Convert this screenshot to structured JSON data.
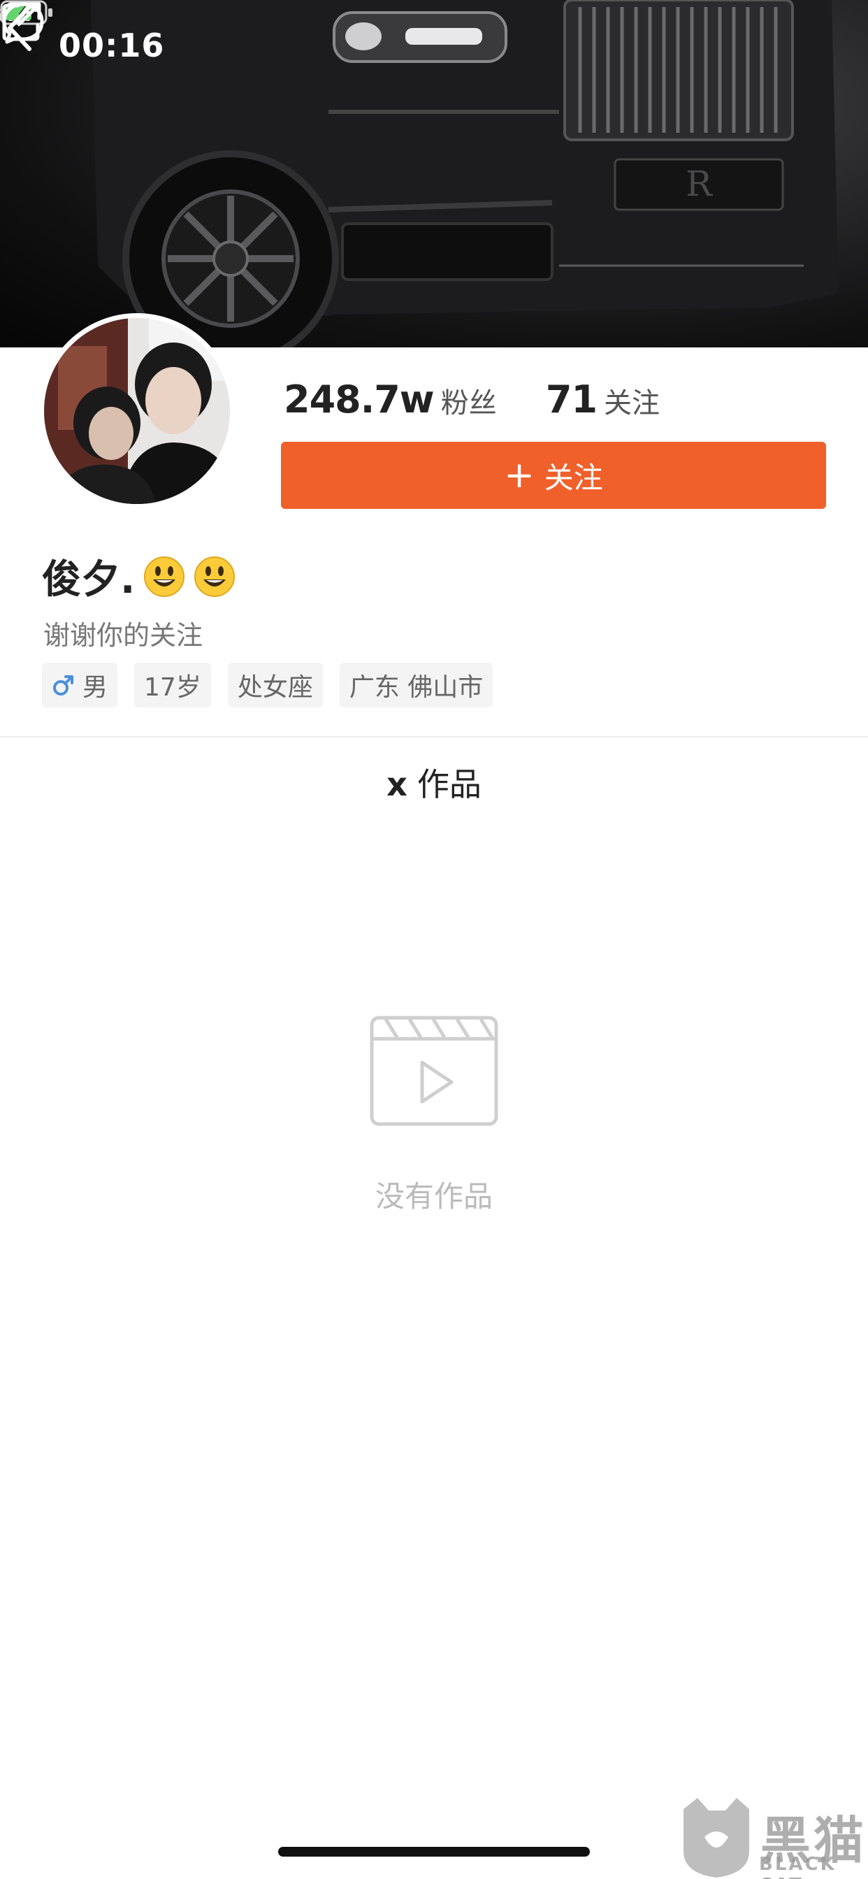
{
  "status_bar": {
    "time": "00:16"
  },
  "profile": {
    "fans_count": "248.7w",
    "fans_label": "粉丝",
    "following_count": "71",
    "following_label": "关注",
    "follow_button_plus": "+",
    "follow_button_label": "关注",
    "name": "俊夕.",
    "bio": "谢谢你的关注",
    "tags": {
      "gender": "男",
      "age": "17岁",
      "zodiac": "处女座",
      "location": "广东 佛山市"
    }
  },
  "works": {
    "count": "x",
    "tab_label": "作品",
    "empty_text": "没有作品"
  },
  "watermark": {
    "text_cn": "黑猫",
    "text_en": "BLACK CAT"
  },
  "colors": {
    "accent": "#f0602a",
    "gender_icon": "#4a90d9",
    "battery_fill": "#65d46e"
  },
  "icons": {
    "back": "chevron-left-icon",
    "message": "chat-bubble-icon",
    "share": "share-external-icon",
    "location": "location-arrow-icon",
    "signal": "cellular-signal-icon",
    "wifi": "wifi-icon",
    "battery": "battery-charging-icon",
    "gender": "male-icon",
    "empty": "video-clapper-icon"
  }
}
